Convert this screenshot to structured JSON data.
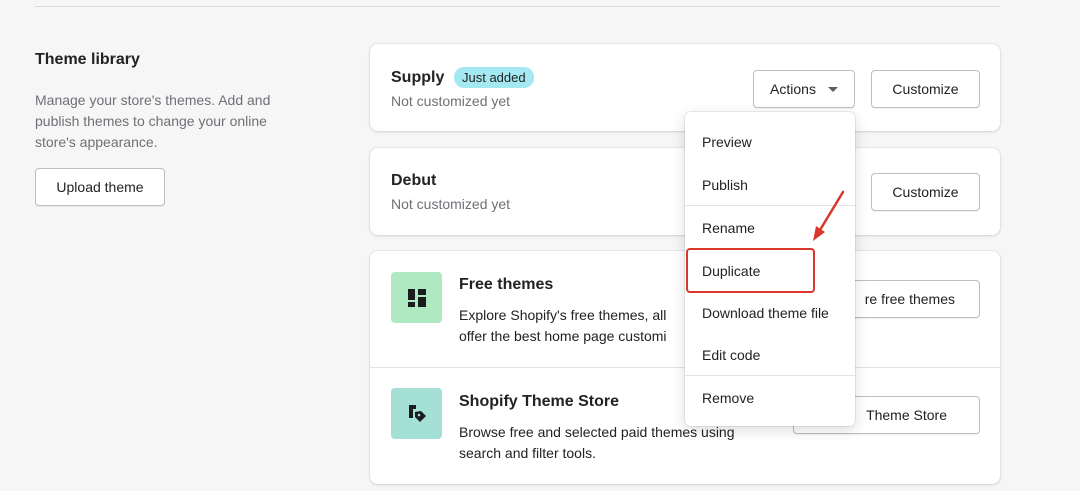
{
  "section": {
    "title": "Theme library",
    "description": "Manage your store's themes. Add and publish themes to change your online store's appearance.",
    "upload_label": "Upload theme"
  },
  "themes": [
    {
      "name": "Supply",
      "badge": "Just added",
      "status": "Not customized yet",
      "actions_label": "Actions",
      "customize_label": "Customize"
    },
    {
      "name": "Debut",
      "status": "Not customized yet",
      "customize_label": "Customize"
    }
  ],
  "free_themes": {
    "title": "Free themes",
    "description": "Explore Shopify's free themes, all offer the best home page customi",
    "button_label": "re free themes"
  },
  "theme_store": {
    "title": "Shopify Theme Store",
    "description": "Browse free and selected paid themes using search and filter tools.",
    "button_label": "Theme Store"
  },
  "actions_menu": {
    "items": [
      "Preview",
      "Publish",
      "Rename",
      "Duplicate",
      "Download theme file",
      "Edit code",
      "Remove"
    ],
    "highlighted": "Duplicate"
  },
  "colors": {
    "badge": "#a4e8f2",
    "free_themes_tile": "#aee9c1",
    "theme_store_tile": "#a4e0d6",
    "annotation": "#d9372c"
  }
}
